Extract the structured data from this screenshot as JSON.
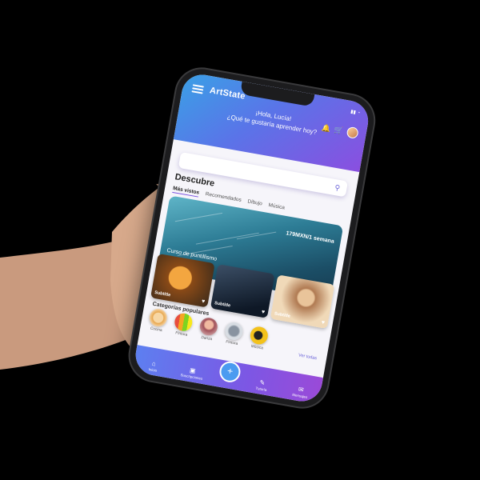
{
  "app": {
    "title": "ArtState",
    "greeting_line1": "¡Hola, Lucía!",
    "greeting_line2": "¿Qué te gustaría aprender hoy?",
    "search_placeholder": ""
  },
  "discover": {
    "title": "Descubre",
    "tabs": [
      "Más vistos",
      "Recomendados",
      "Dibujo",
      "Música"
    ]
  },
  "feature": {
    "price": "179MXN/1 semana",
    "title": "Curso de puntillismo",
    "subtitle": "por Name"
  },
  "cards": [
    "Subtitle",
    "Subtitle",
    "Subtitle"
  ],
  "categories": {
    "title": "Categorías populares",
    "see_all": "Ver todas",
    "items": [
      {
        "label": "Cocina",
        "color": "#f2c28a"
      },
      {
        "label": "Pintura",
        "color": "#f08a3c"
      },
      {
        "label": "Danza",
        "color": "#d9a4a4"
      },
      {
        "label": "Pintura",
        "color": "#b8c2cc"
      },
      {
        "label": "Música",
        "color": "#f3c21b"
      }
    ]
  },
  "bottom_nav": [
    {
      "label": "Inicio",
      "icon": "home-icon"
    },
    {
      "label": "Suscripciones",
      "icon": "subscriptions-icon"
    },
    {
      "label": "Tutoría",
      "icon": "tutoring-icon"
    },
    {
      "label": "Mensajes",
      "icon": "messages-icon"
    }
  ]
}
